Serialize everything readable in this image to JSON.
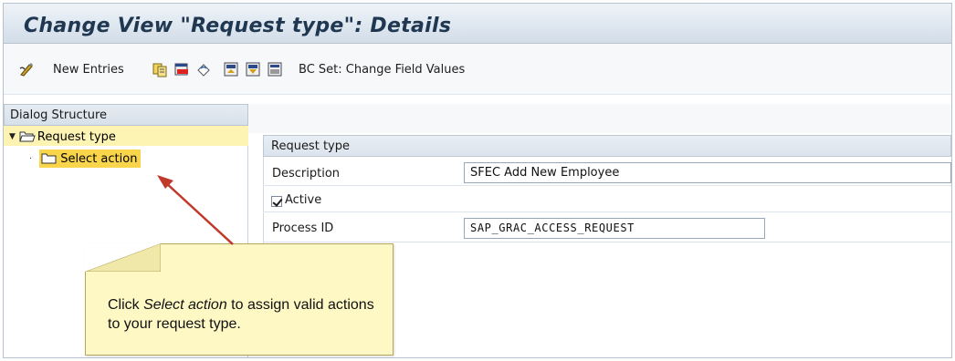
{
  "window": {
    "title": "Change View \"Request type\": Details"
  },
  "toolbar": {
    "new_entries_label": "New Entries",
    "bc_set_label": "BC Set: Change Field Values",
    "icons": [
      "display-change-icon",
      "copy-icon",
      "delete-icon",
      "undo-icon",
      "previous-entry-icon",
      "next-entry-icon",
      "select-all-icon"
    ]
  },
  "dialog_structure": {
    "header": "Dialog Structure",
    "items": [
      {
        "label": "Request type",
        "icon": "open-folder-icon",
        "expanded": true
      },
      {
        "label": "Select action",
        "icon": "folder-icon",
        "selected": true
      }
    ]
  },
  "detail": {
    "group_title": "Request type",
    "fields": {
      "description_label": "Description",
      "description_value": "SFEC Add New Employee",
      "active_label": "Active",
      "active_checked": true,
      "process_id_label": "Process ID",
      "process_id_value": "SAP_GRAC_ACCESS_REQUEST"
    }
  },
  "callout": {
    "text_before": "Click ",
    "text_emphasis": "Select action",
    "text_after": " to assign valid actions to your request type."
  },
  "colors": {
    "title_text": "#1f3750",
    "tree_selected": "#f8d54a",
    "tree_row_highlight": "#fdf3b2",
    "callout_bg": "#fdf8c4",
    "arrow": "#c0392b"
  }
}
